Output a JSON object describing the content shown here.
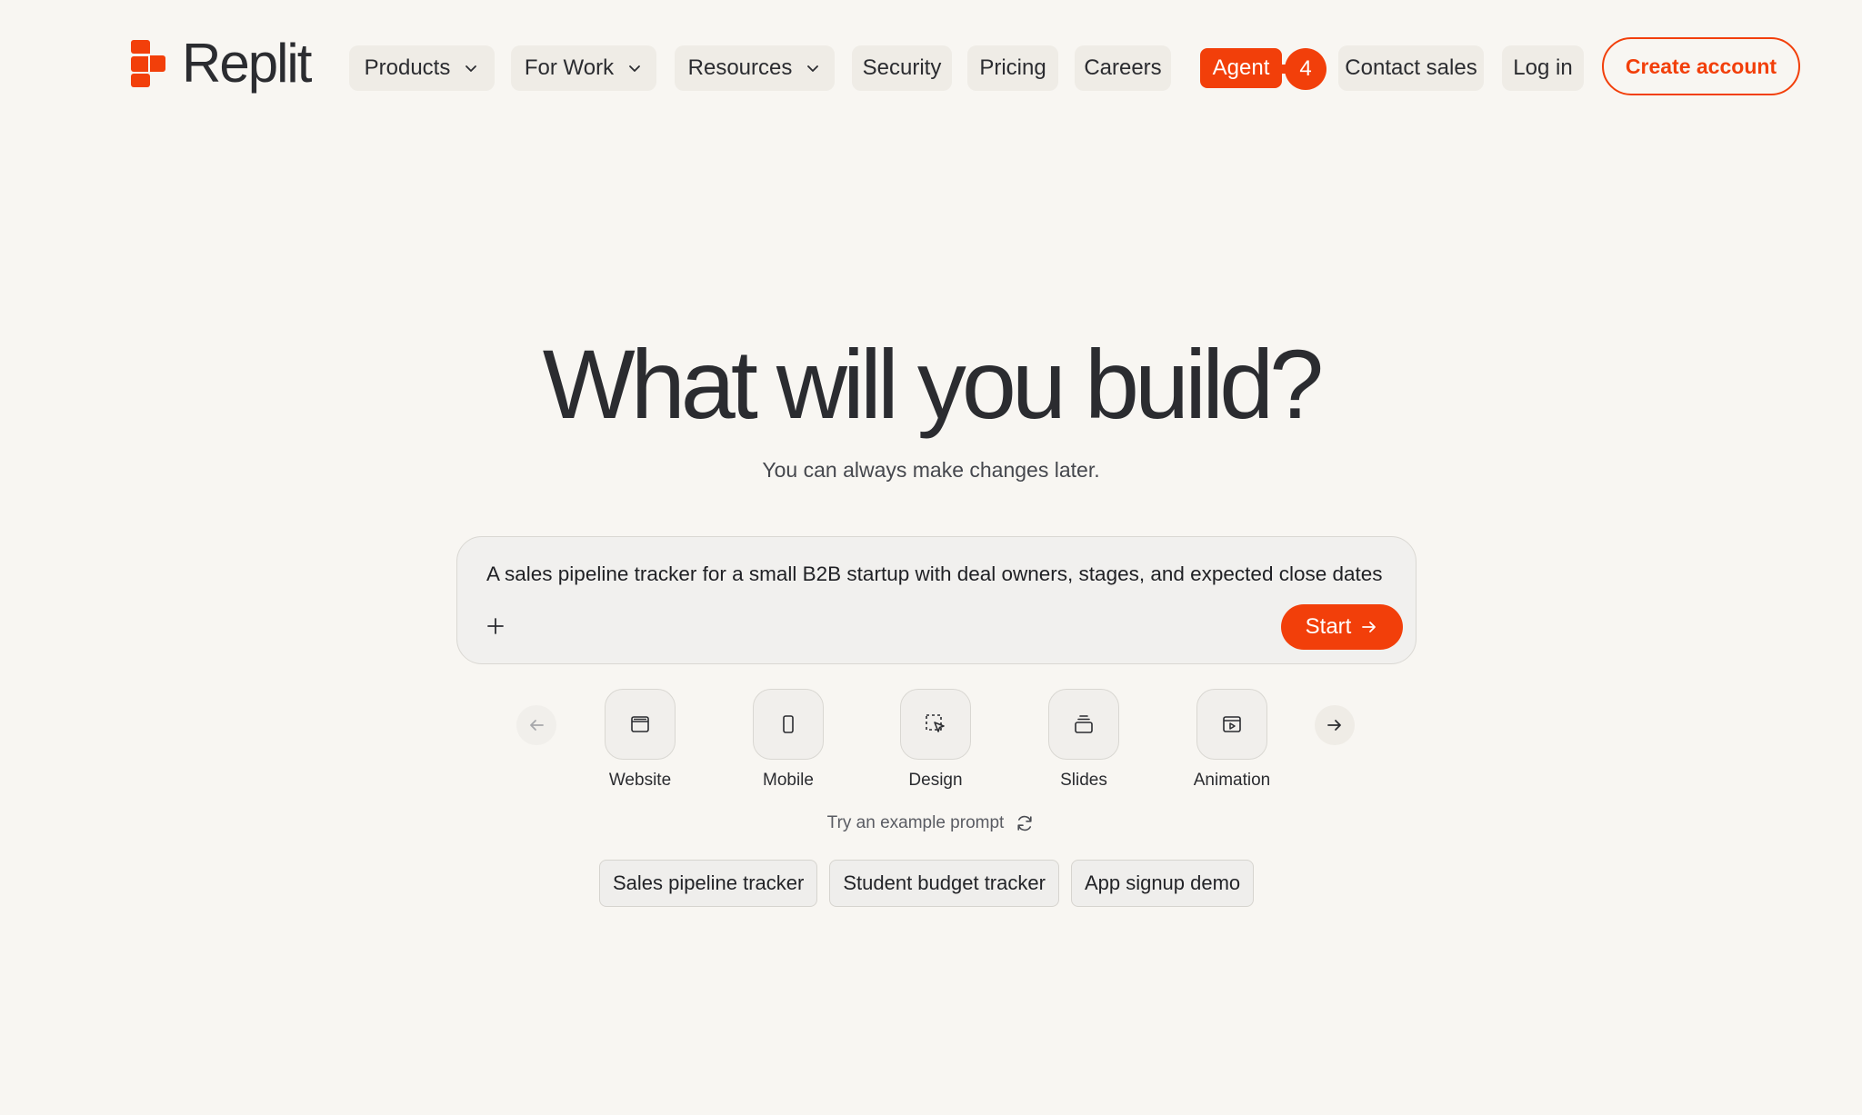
{
  "brand": {
    "name": "Replit",
    "accent_color": "#f23f0a"
  },
  "nav": {
    "products": "Products",
    "for_work": "For Work",
    "resources": "Resources",
    "security": "Security",
    "pricing": "Pricing",
    "careers": "Careers",
    "agent": "Agent",
    "agent_badge": "4",
    "contact_sales": "Contact sales",
    "log_in": "Log in",
    "create_account": "Create account"
  },
  "hero": {
    "title": "What will you build?",
    "subtitle": "You can always make changes later."
  },
  "prompt": {
    "value": "A sales pipeline tracker for a small B2B startup with deal owners, stages, and expected close dates",
    "start_label": "Start"
  },
  "types": [
    {
      "label": "Website",
      "icon": "browser-window-icon"
    },
    {
      "label": "Mobile",
      "icon": "phone-icon"
    },
    {
      "label": "Design",
      "icon": "select-cursor-icon"
    },
    {
      "label": "Slides",
      "icon": "slides-stack-icon"
    },
    {
      "label": "Animation",
      "icon": "video-play-icon"
    }
  ],
  "examples": {
    "label": "Try an example prompt",
    "chips": [
      "Sales pipeline tracker",
      "Student budget tracker",
      "App signup demo"
    ]
  }
}
